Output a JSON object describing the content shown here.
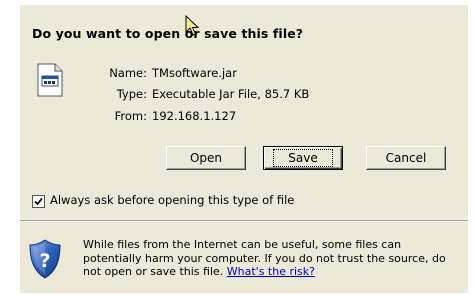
{
  "dialog": {
    "question": "Do you want to open or save this file?",
    "file": {
      "name_label": "Name:",
      "name_value": "TMsoftware.jar",
      "type_label": "Type:",
      "type_value": "Executable Jar File, 85.7 KB",
      "from_label": "From:",
      "from_value": "192.168.1.127"
    },
    "buttons": {
      "open": "Open",
      "save": "Save",
      "cancel": "Cancel"
    },
    "checkbox": {
      "label": "Always ask before opening this type of file",
      "checked": true
    },
    "warning": {
      "text": "While files from the Internet can be useful, some files can potentially harm your computer. If you do not trust the source, do not open or save this file.",
      "link": "What's the risk?"
    },
    "colors": {
      "dialog_bg": "#ece9d8",
      "shield_blue": "#2f5fb8",
      "link": "#0000cc"
    },
    "icons": [
      "jar-file-icon",
      "shield-question-icon",
      "mouse-cursor-icon",
      "checkmark-icon"
    ]
  }
}
